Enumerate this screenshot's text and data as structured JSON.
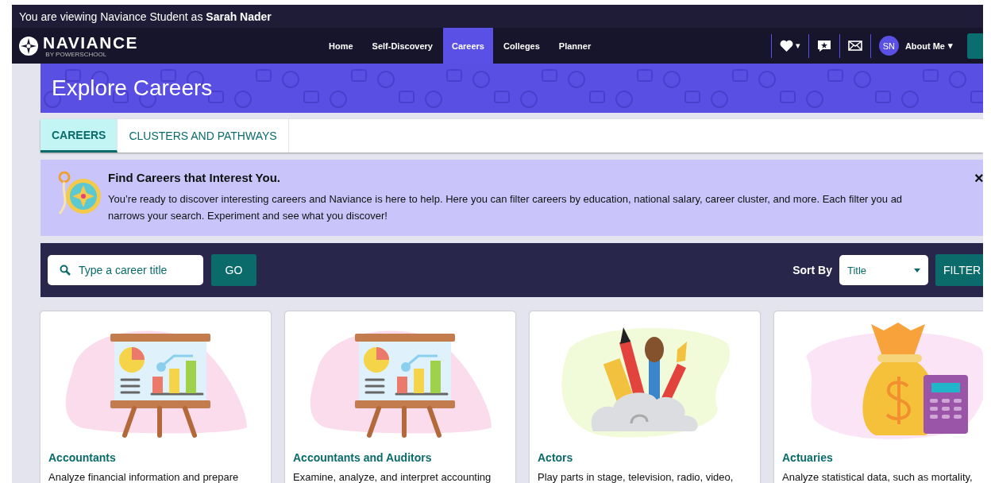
{
  "viewing_banner": {
    "text": "You are viewing Naviance Student as **Sarah Nader**"
  },
  "header": {
    "logo": "NAVIANCE",
    "logo_sub": "BY POWERSCHOOL",
    "nav": [
      {
        "label": "Home",
        "selected": false
      },
      {
        "label": "Self-Discovery",
        "selected": false
      },
      {
        "label": "Careers",
        "selected": true
      },
      {
        "label": "Colleges",
        "selected": false
      },
      {
        "label": "Planner",
        "selected": false
      }
    ],
    "favorites_caret": "▾",
    "avatar": "SN",
    "profile": "About Me",
    "profile_caret": "▾"
  },
  "page_title": "Explore Careers",
  "tabs": [
    {
      "label": "CAREERS",
      "selected": true
    },
    {
      "label": "CLUSTERS AND PATHWAYS",
      "selected": false
    }
  ],
  "info": {
    "title": "Find Careers that Interest You.",
    "text": "You’re ready to discover interesting careers and Naviance is here to help. Here you can filter careers by education, national salary, career cluster, and more. Each filter you ad\nnarrows your search. Experiment and see what you discover!",
    "close": "×"
  },
  "search": {
    "placeholder": "Type a career title",
    "go": "GO",
    "sort_label": "Sort By",
    "sort_value": "Title",
    "filter": "FILTER"
  },
  "careers": [
    {
      "kind": "presentation",
      "title": "Accountants",
      "description": "Analyze financial information and prepare"
    },
    {
      "kind": "presentation",
      "title": "Accountants and Auditors",
      "description": "Examine, analyze, and interpret accounting"
    },
    {
      "kind": "art-supplies",
      "title": "Actors",
      "description": "Play parts in stage, television, radio, video,"
    },
    {
      "kind": "money",
      "title": "Actuaries",
      "description": "Analyze statistical data, such as mortality,"
    }
  ]
}
